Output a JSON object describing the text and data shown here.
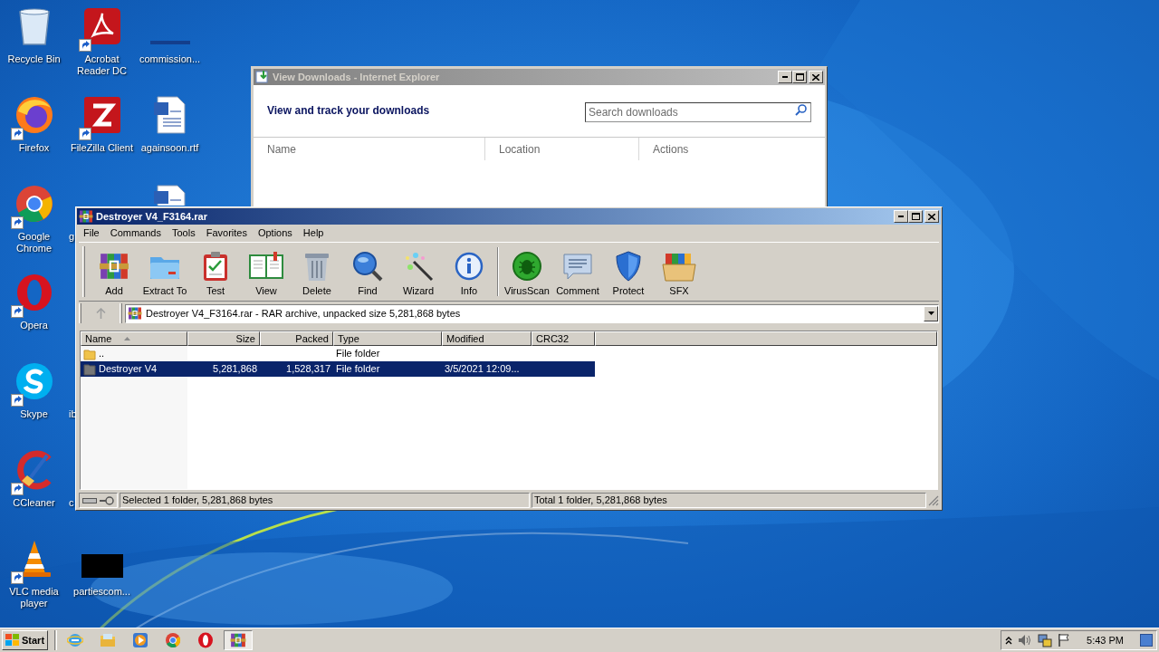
{
  "desktop": {
    "icons": [
      {
        "label": "Recycle Bin",
        "kind": "recycle",
        "shortcut": false
      },
      {
        "label": "Acrobat Reader DC",
        "kind": "pdf",
        "shortcut": true
      },
      {
        "label": "commission...",
        "kind": "blank",
        "shortcut": false
      },
      {
        "label": "Firefox",
        "kind": "firefox",
        "shortcut": true
      },
      {
        "label": "FileZilla Client",
        "kind": "filezilla",
        "shortcut": true
      },
      {
        "label": "againsoon.rtf",
        "kind": "word",
        "shortcut": false
      },
      {
        "label": "Google Chrome",
        "kind": "chrome",
        "shortcut": true
      },
      {
        "kind": "word",
        "shortcut": false
      },
      {
        "label": "Opera",
        "kind": "opera",
        "shortcut": true
      },
      {
        "label": "Skype",
        "kind": "skype",
        "shortcut": true
      },
      {
        "label": "CCleaner",
        "kind": "ccleaner",
        "shortcut": true
      },
      {
        "label": "VLC media player",
        "kind": "vlc",
        "shortcut": true
      },
      {
        "label": "partiescom...",
        "kind": "black",
        "shortcut": false
      }
    ],
    "hidden_labels": [
      "g",
      "ib",
      "c"
    ]
  },
  "downloads_window": {
    "title": "View Downloads - Internet Explorer",
    "active": false,
    "heading": "View and track your downloads",
    "search": {
      "placeholder": "Search downloads"
    },
    "columns": [
      "Name",
      "Location",
      "Actions"
    ]
  },
  "archive_window": {
    "title": "Destroyer V4_F3164.rar",
    "active": true,
    "menu": [
      "File",
      "Commands",
      "Tools",
      "Favorites",
      "Options",
      "Help"
    ],
    "toolbar": [
      {
        "label": "Add",
        "kind": "add"
      },
      {
        "label": "Extract To",
        "kind": "extract"
      },
      {
        "label": "Test",
        "kind": "test"
      },
      {
        "label": "View",
        "kind": "view"
      },
      {
        "label": "Delete",
        "kind": "delete"
      },
      {
        "label": "Find",
        "kind": "find"
      },
      {
        "label": "Wizard",
        "kind": "wizard"
      },
      {
        "label": "Info",
        "kind": "info"
      },
      {
        "label": "VirusScan",
        "kind": "virus"
      },
      {
        "label": "Comment",
        "kind": "comment"
      },
      {
        "label": "Protect",
        "kind": "protect"
      },
      {
        "label": "SFX",
        "kind": "sfx"
      }
    ],
    "path": "Destroyer V4_F3164.rar - RAR archive, unpacked size 5,281,868 bytes",
    "columns": [
      {
        "label": "Name",
        "sorted": true
      },
      {
        "label": "Size",
        "sorted": false
      },
      {
        "label": "Packed",
        "sorted": false
      },
      {
        "label": "Type",
        "sorted": false
      },
      {
        "label": "Modified",
        "sorted": false
      },
      {
        "label": "CRC32",
        "sorted": false
      }
    ],
    "rows": [
      {
        "kind": "parent",
        "cells": [
          "..",
          null,
          null,
          "File folder",
          null,
          null
        ],
        "selected": false
      },
      {
        "kind": "folder",
        "cells": [
          "Destroyer V4",
          "5,281,868",
          "1,528,317",
          "File folder",
          "3/5/2021 12:09...",
          null
        ],
        "selected": true
      }
    ],
    "status_left": "Selected 1 folder, 5,281,868 bytes",
    "status_right": "Total 1 folder, 5,281,868 bytes"
  },
  "taskbar": {
    "start": "Start",
    "buttons": [
      {
        "kind": "ie",
        "active": false
      },
      {
        "kind": "explorer",
        "active": false
      },
      {
        "kind": "media",
        "active": false
      },
      {
        "kind": "chrome",
        "active": false
      },
      {
        "kind": "opera",
        "active": false
      },
      {
        "kind": "winrar",
        "active": true
      }
    ],
    "time": "5:43 PM"
  }
}
